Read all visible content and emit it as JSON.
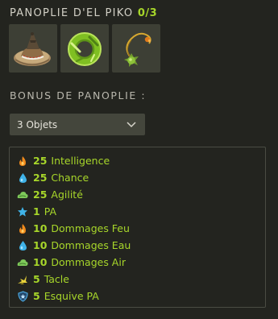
{
  "set": {
    "title": "PANOPLIE D'EL PIKO",
    "progress": "0/3",
    "items": [
      {
        "icon": "sombrero-hat-icon"
      },
      {
        "icon": "green-belt-ring-icon"
      },
      {
        "icon": "spiked-amulet-icon"
      }
    ]
  },
  "bonus": {
    "title": "BONUS DE PANOPLIE :",
    "selected_option": "3 Objets",
    "lines": [
      {
        "icon": "fire-intelligence-icon",
        "value": "25",
        "label": "Intelligence"
      },
      {
        "icon": "water-chance-icon",
        "value": "25",
        "label": "Chance"
      },
      {
        "icon": "air-agility-icon",
        "value": "25",
        "label": "Agilité"
      },
      {
        "icon": "star-pa-icon",
        "value": "1",
        "label": "PA"
      },
      {
        "icon": "fire-damage-icon",
        "value": "10",
        "label": "Dommages Feu"
      },
      {
        "icon": "water-damage-icon",
        "value": "10",
        "label": "Dommages Eau"
      },
      {
        "icon": "air-damage-icon",
        "value": "10",
        "label": "Dommages Air"
      },
      {
        "icon": "tackle-icon",
        "value": "5",
        "label": "Tacle"
      },
      {
        "icon": "shield-star-icon",
        "value": "5",
        "label": "Esquive PA"
      }
    ]
  },
  "colors": {
    "background": "#23241f",
    "accent_green": "#a7d62a",
    "fire": "#f08a1c",
    "water": "#3fb3e8",
    "air": "#7ec95a"
  }
}
